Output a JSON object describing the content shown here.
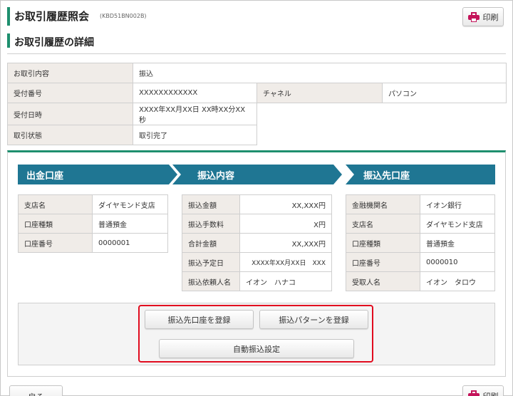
{
  "header": {
    "title": "お取引履歴照会",
    "code": "(KBD51BN002B)",
    "print_label": "印刷"
  },
  "subtitle": "お取引履歴の詳細",
  "info": {
    "row1": {
      "label": "お取引内容",
      "value": "振込"
    },
    "row2": {
      "label": "受付番号",
      "value": "XXXXXXXXXXXX",
      "label2": "チャネル",
      "value2": "パソコン"
    },
    "row3": {
      "label": "受付日時",
      "value": "XXXX年XX月XX日 XX時XX分XX秒"
    },
    "row4": {
      "label": "取引状態",
      "value": "取引完了"
    }
  },
  "sections": {
    "source": {
      "title": "出金口座",
      "rows": [
        {
          "label": "支店名",
          "value": "ダイヤモンド支店"
        },
        {
          "label": "口座種類",
          "value": "普通預金"
        },
        {
          "label": "口座番号",
          "value": "0000001"
        }
      ]
    },
    "transfer": {
      "title": "振込内容",
      "rows": [
        {
          "label": "振込金額",
          "value": "XX,XXX円"
        },
        {
          "label": "振込手数料",
          "value": "X円"
        },
        {
          "label": "合計金額",
          "value": "XX,XXX円"
        },
        {
          "label": "振込予定日",
          "value": "XXXX年XX月XX日　XXX"
        },
        {
          "label": "振込依頼人名",
          "value": "イオン　ハナコ"
        }
      ]
    },
    "dest": {
      "title": "振込先口座",
      "rows": [
        {
          "label": "金融機関名",
          "value": "イオン銀行"
        },
        {
          "label": "支店名",
          "value": "ダイヤモンド支店"
        },
        {
          "label": "口座種類",
          "value": "普通預金"
        },
        {
          "label": "口座番号",
          "value": "0000010"
        },
        {
          "label": "受取人名",
          "value": "イオン　タロウ"
        }
      ]
    }
  },
  "actions": {
    "register_dest": "振込先口座を登録",
    "register_pattern": "振込パターンを登録",
    "auto_transfer": "自動振込設定"
  },
  "footer": {
    "back_label": "戻る",
    "print_label": "印刷"
  },
  "colors": {
    "accent_green": "#1e8f6e",
    "section_blue": "#1f7693",
    "highlight_red": "#e10c1f",
    "label_bg": "#f0ece8"
  }
}
